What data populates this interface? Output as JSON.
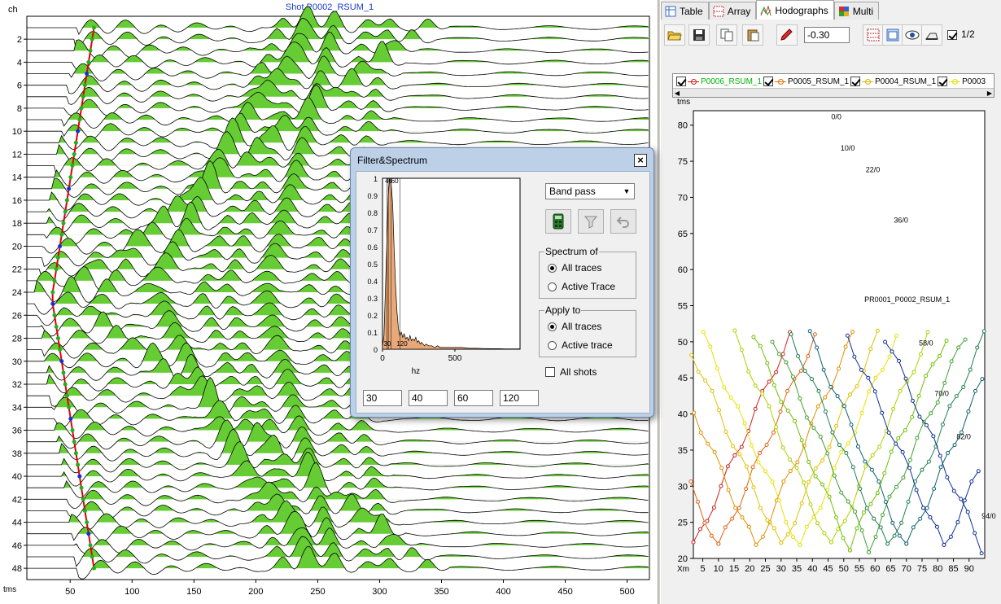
{
  "seismogram": {
    "title": "Shot P0002_RSUM_1",
    "ch_label": "ch",
    "x_unit_label": "tms",
    "channel_ticks": [
      "2",
      "4",
      "6",
      "8",
      "10",
      "12",
      "14",
      "16",
      "18",
      "20",
      "22",
      "24",
      "26",
      "28",
      "30",
      "32",
      "34",
      "36",
      "38",
      "40",
      "42",
      "44",
      "46",
      "48"
    ],
    "time_ticks": [
      "50",
      "100",
      "150",
      "200",
      "250",
      "300",
      "350",
      "400",
      "450",
      "500"
    ],
    "fill_color": "#66cc33",
    "pick_line_color": "#e00000",
    "pick_marker_color": "#1030e0"
  },
  "tabs": [
    {
      "label": "Table",
      "icon": "table-icon"
    },
    {
      "label": "Array",
      "icon": "array-icon"
    },
    {
      "label": "Hodographs",
      "icon": "hodographs-icon",
      "active": true
    },
    {
      "label": "Multi",
      "icon": "multi-icon"
    }
  ],
  "toolbar": {
    "value": "-0.30",
    "half_label": "1/2",
    "half_checked": true
  },
  "legend": {
    "items": [
      {
        "label": "P0006_RSUM_1",
        "color": "#00b000",
        "line_color": "#d02020"
      },
      {
        "label": "P0005_RSUM_1",
        "color": "#000000",
        "line_color": "#e07000"
      },
      {
        "label": "P0004_RSUM_1",
        "color": "#000000",
        "line_color": "#e0b000"
      },
      {
        "label": "P0003",
        "color": "#000000",
        "line_color": "#e0e000"
      }
    ]
  },
  "hodograph": {
    "y_unit": "tms",
    "x_unit": "Xm",
    "y_ticks": [
      "80",
      "75",
      "70",
      "65",
      "60",
      "55",
      "50",
      "45",
      "40",
      "35",
      "30",
      "25",
      "20"
    ],
    "x_ticks": [
      "5",
      "10",
      "15",
      "20",
      "25",
      "30",
      "35",
      "40",
      "45",
      "50",
      "55",
      "60",
      "65",
      "70",
      "75",
      "80",
      "85",
      "90"
    ],
    "annotations": [
      "0/0",
      "10/0",
      "22/0",
      "36/0",
      "PR0001_P0002_RSUM_1",
      "58/0",
      "70/0",
      "82/0",
      "94/0"
    ]
  },
  "dialog": {
    "title": "Filter&Spectrum",
    "filter_type": "Band pass",
    "spectrum_group": "Spectrum of",
    "spectrum_options": [
      "All traces",
      "Active Trace"
    ],
    "apply_group": "Apply to",
    "apply_options": [
      "All traces",
      "Active trace"
    ],
    "all_shots_label": "All shots",
    "freq_inputs": [
      "30",
      "40",
      "60",
      "120"
    ],
    "spectrum_color": "#e8a878",
    "chart_data": {
      "type": "area",
      "xlabel": "hz",
      "x_ticks": [
        "0",
        "500"
      ],
      "y_ticks": [
        "1",
        "0.9",
        "0.8",
        "0.7",
        "0.6",
        "0.5",
        "0.4",
        "0.3",
        "0.2",
        "0.1",
        "0"
      ],
      "ylim": [
        0,
        1
      ],
      "xlim": [
        0,
        950
      ],
      "marker_labels": [
        "40",
        "60",
        "30",
        "120"
      ],
      "x": [
        0,
        10,
        20,
        30,
        40,
        50,
        60,
        70,
        80,
        90,
        100,
        110,
        120,
        130,
        140,
        150,
        160,
        170,
        180,
        190,
        200,
        210,
        220,
        230,
        240,
        250,
        260,
        270,
        280,
        290,
        300,
        320,
        340,
        360,
        380,
        400,
        450,
        500,
        550,
        600,
        650,
        700,
        750,
        800,
        850,
        900,
        950
      ],
      "values": [
        0.02,
        0.08,
        0.35,
        0.62,
        0.9,
        1.0,
        0.97,
        0.85,
        0.6,
        0.38,
        0.22,
        0.12,
        0.08,
        0.1,
        0.07,
        0.09,
        0.06,
        0.07,
        0.05,
        0.08,
        0.05,
        0.06,
        0.05,
        0.07,
        0.04,
        0.05,
        0.03,
        0.04,
        0.03,
        0.02,
        0.03,
        0.02,
        0.02,
        0.01,
        0.02,
        0.01,
        0.01,
        0.01,
        0.01,
        0.005,
        0.005,
        0.004,
        0.003,
        0.003,
        0.002,
        0.002,
        0.002
      ]
    }
  }
}
